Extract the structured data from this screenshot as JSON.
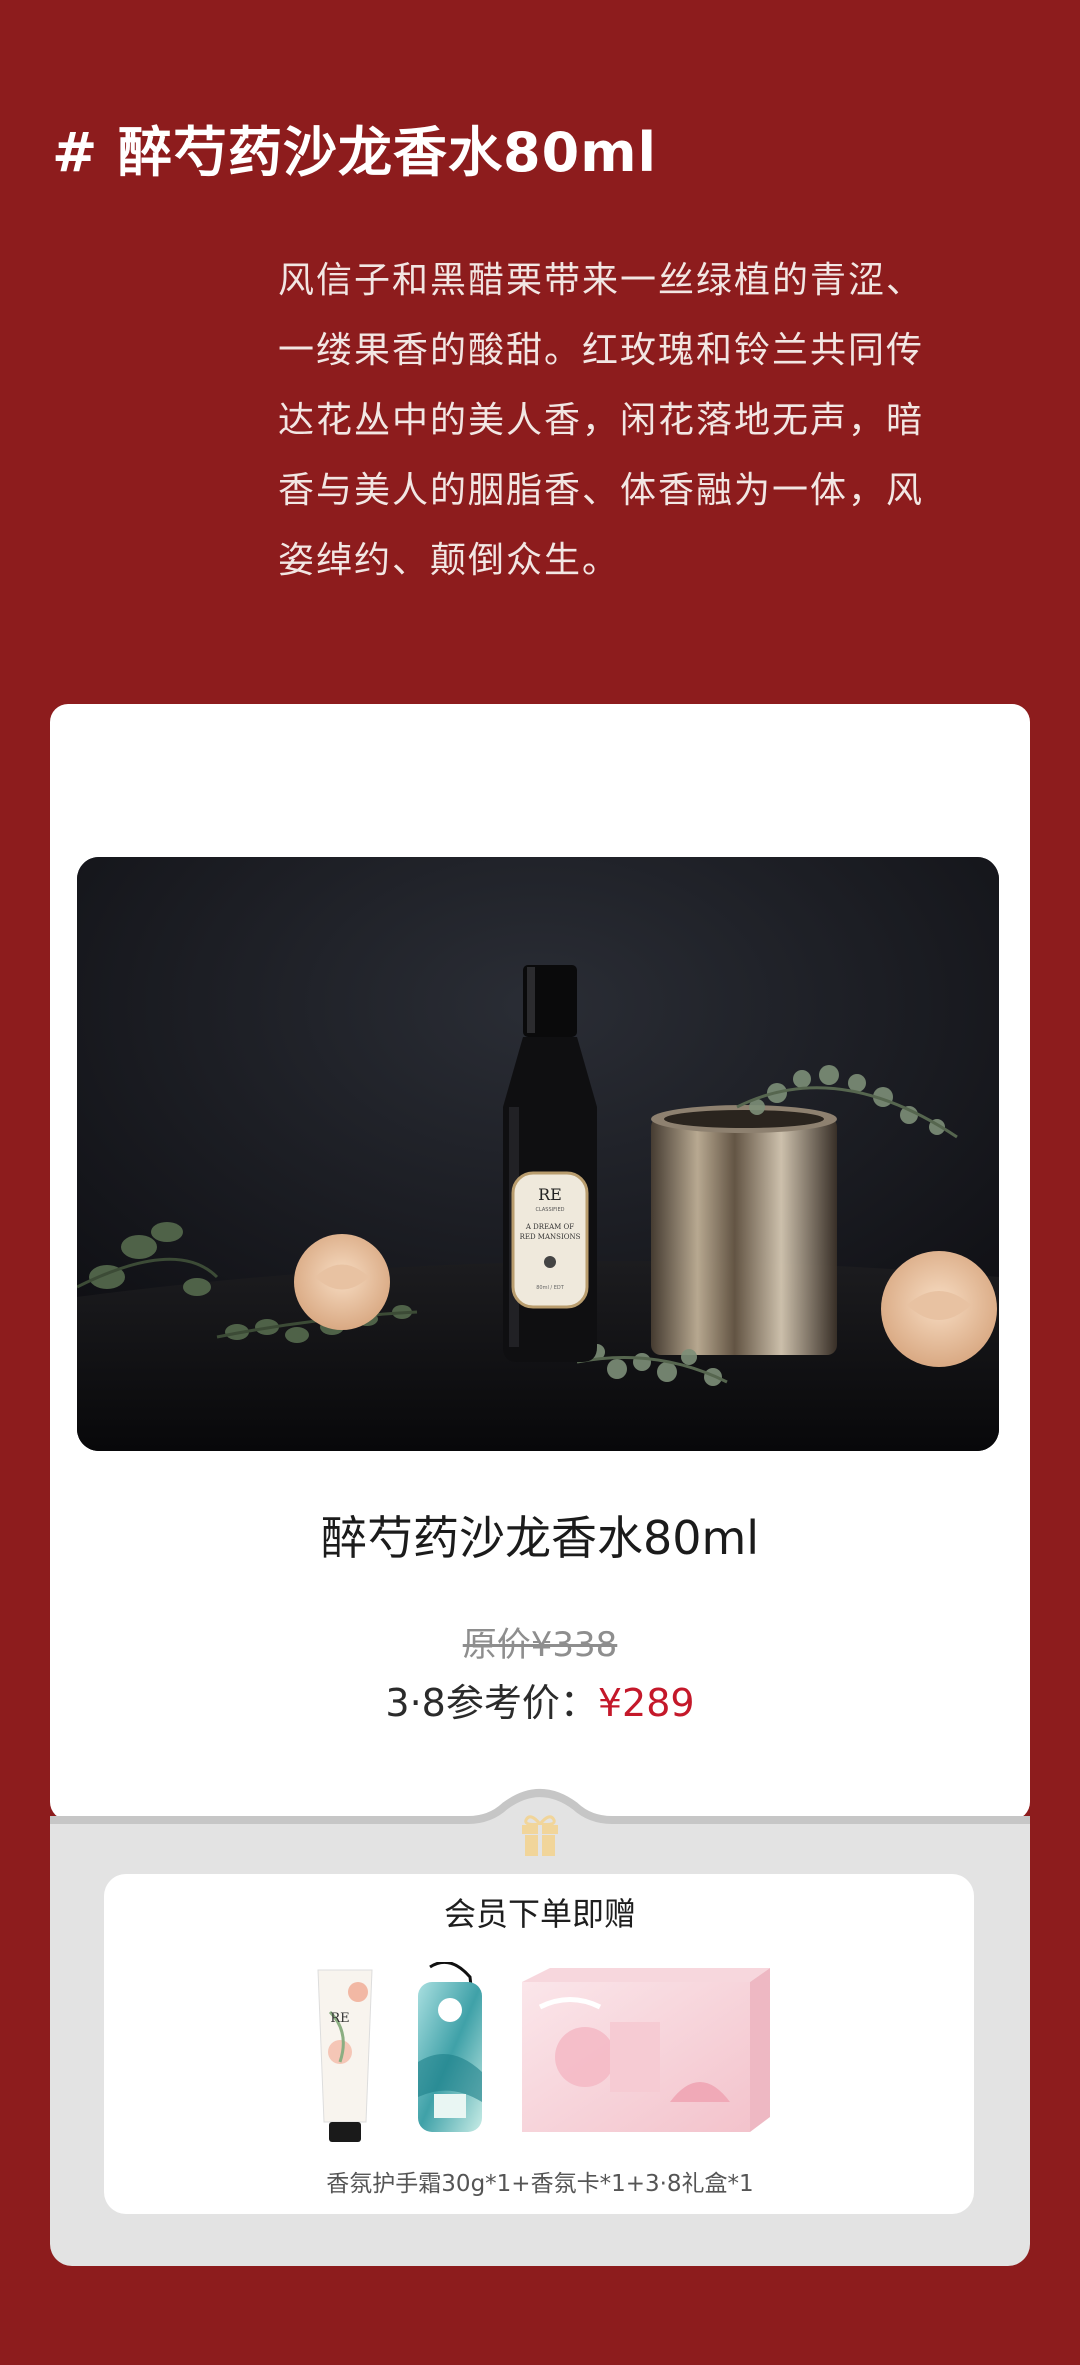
{
  "header": {
    "heading": "# 醉芍药沙龙香水80ml",
    "intro_lines": [
      "风信子和黑醋栗带来一丝绿植的青涩、",
      "一缕果香的酸甜。红玫瑰和铃兰共同传",
      "达花丛中的美人香，闲花落地无声，暗",
      "香与美人的胭脂香、体香融为一体，风",
      "姿绰约、颠倒众生。"
    ]
  },
  "product": {
    "title": "醉芍药沙龙香水80ml",
    "original_price": "原价¥338",
    "price_label": "3·8参考价：",
    "price_value": "¥289",
    "bottle_label": {
      "brand": "RE",
      "sub": "CLASSIFIED",
      "line1": "A DREAM OF",
      "line2": "RED MANSIONS",
      "volume": "80ml / EDT"
    }
  },
  "gift": {
    "title": "会员下单即赠",
    "items": [
      "hand-cream",
      "scent-card",
      "gift-box"
    ],
    "description": "香氛护手霜30g*1+香氛卡*1+3·8礼盒*1",
    "brand_mark": "RE"
  },
  "colors": {
    "background": "#8d1c1d",
    "price_accent": "#c4182a",
    "gift_panel": "#e3e3e3",
    "gift_icon": "#f1d59a"
  }
}
